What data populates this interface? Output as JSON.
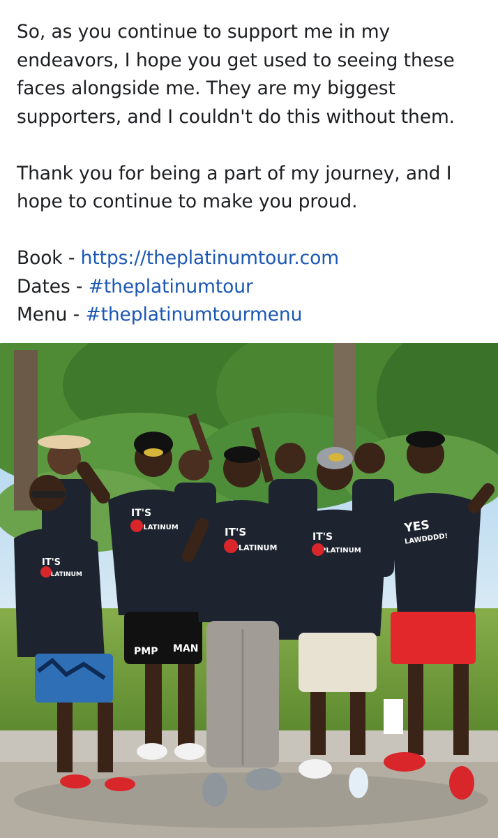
{
  "post": {
    "paragraph1": [
      "So, as you continue to support me in my",
      "endeavors, I hope you get used to seeing these",
      "faces alongside me. They are my biggest",
      "supporters, and I couldn't do this without them."
    ],
    "paragraph2": [
      "Thank you for being a part of my journey, and I",
      "hope to continue to make you proud."
    ],
    "links": [
      {
        "label": "Book - ",
        "value": "https://theplatinumtour.com"
      },
      {
        "label": "Dates - ",
        "value": "#theplatinumtour"
      },
      {
        "label": "Menu - ",
        "value": "#theplatinumtourmenu"
      }
    ]
  },
  "photo": {
    "shirt_brand": "IT'S",
    "shirt_brand_line2": "PLATINUM",
    "shirt_yes": "YES",
    "shirt_yes_line2": "LAWDDDD!",
    "shorts_text_left": "PMP",
    "shorts_text_right": "MAN"
  },
  "colors": {
    "link": "#1b57b4",
    "text": "#1c1e21",
    "sky": "#8fc3e8",
    "trees": "#3f7a2c",
    "grass": "#6e9a3a",
    "pavement": "#b9b3a9",
    "shirt": "#1d2430",
    "accent_red": "#d8262a"
  }
}
